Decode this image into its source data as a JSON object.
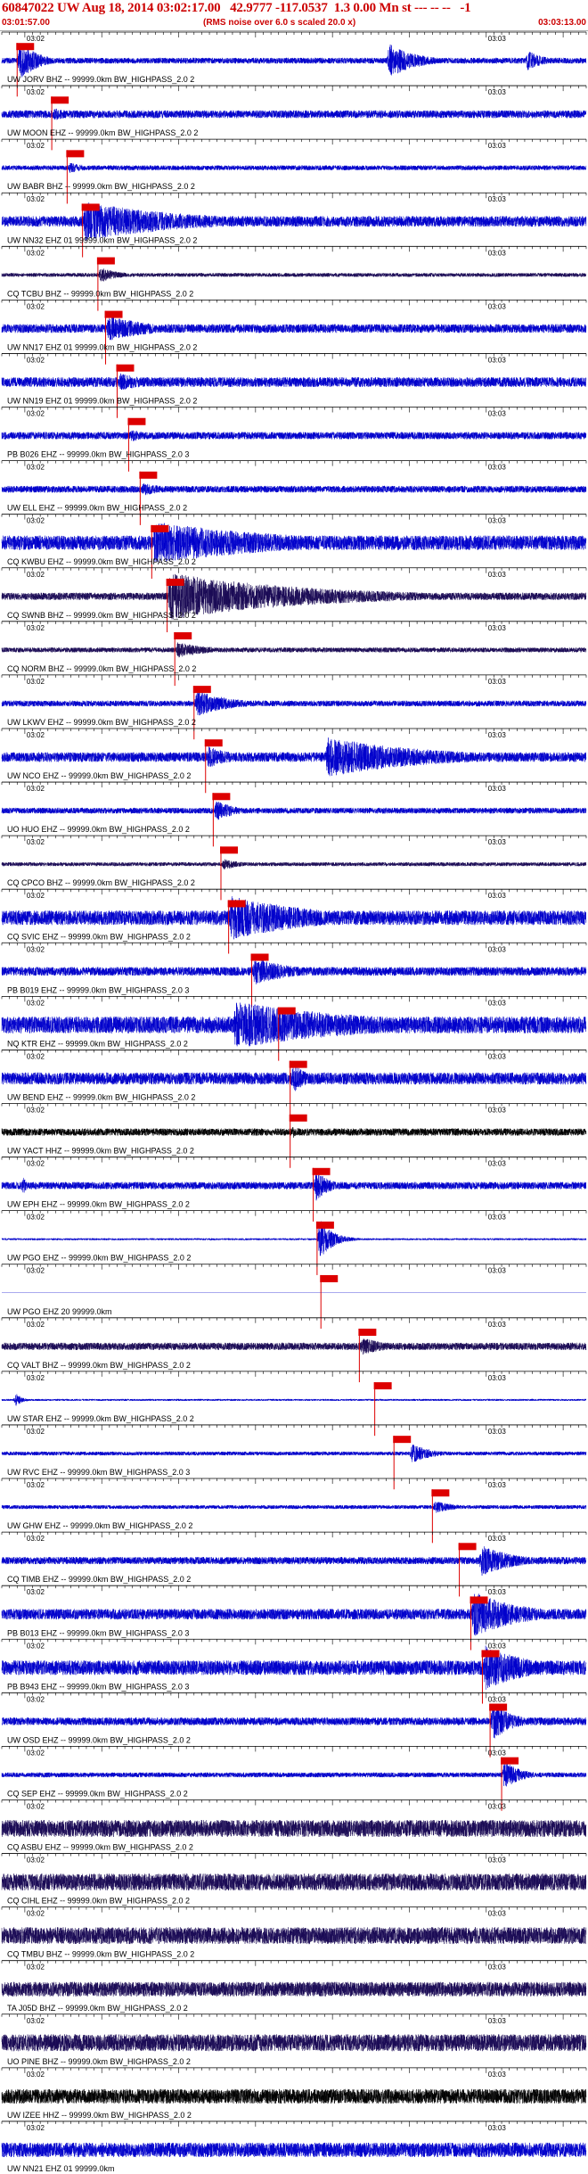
{
  "header": {
    "title": "60847022 UW Aug 18, 2014 03:02:17.00   42.9777 -117.0537  1.3 0.00 Mn st --- -- --   -1",
    "start_time": "03:01:57.00",
    "end_time": "03:03:13.00",
    "note": "(RMS noise over 6.0 s scaled 20.0 x)"
  },
  "colors": {
    "trace_default": "#0000cc",
    "trace_dark": "#1a0a55",
    "trace_black": "#000000",
    "pick": "#dd0000",
    "axis": "#000000",
    "label_text": "#000000"
  },
  "chart_data": {
    "type": "line",
    "title": "60847022 UW Aug 18, 2014 03:02:17.00   42.9777 -117.0537  1.3 0.00 Mn st --- -- --   -1",
    "x_range": [
      "03:01:57.00",
      "03:03:13.00"
    ],
    "axis_tick_labels": [
      "03:02",
      "03:03"
    ],
    "axis_tick_seconds": [
      3,
      63
    ],
    "total_seconds": 76,
    "traces": [
      {
        "label": "UW JORV BHZ -- 99999.0km BW_HIGHPASS_2.0  2",
        "pick": 2.0,
        "events": [
          {
            "t": 2.0,
            "dur": 5,
            "amp": 1.0
          },
          {
            "t": 50,
            "dur": 8,
            "amp": 0.8
          },
          {
            "t": 68,
            "dur": 5,
            "amp": 0.5
          }
        ],
        "noise": 0.12,
        "tone": "blue"
      },
      {
        "label": "UW MOON EHZ -- 99999.0km BW_HIGHPASS_2.0  2",
        "pick": 6.5,
        "events": [
          {
            "t": 6.5,
            "dur": 6,
            "amp": 0.3
          }
        ],
        "noise": 0.16,
        "tone": "blue"
      },
      {
        "label": "UW BABR BHZ -- 99999.0km BW_HIGHPASS_2.0  2",
        "pick": 8.5,
        "events": [
          {
            "t": 8.5,
            "dur": 6,
            "amp": 0.25
          }
        ],
        "noise": 0.1,
        "tone": "blue"
      },
      {
        "label": "UW NN32 EHZ 01 99999.0km BW_HIGHPASS_2.0  2",
        "pick": 10.5,
        "events": [
          {
            "t": 10.5,
            "dur": 30,
            "amp": 0.85
          }
        ],
        "noise": 0.22,
        "tone": "blue"
      },
      {
        "label": "CQ TCBU BHZ -- 99999.0km BW_HIGHPASS_2.0  2",
        "pick": 12.5,
        "events": [
          {
            "t": 12.5,
            "dur": 6,
            "amp": 0.35
          }
        ],
        "noise": 0.08,
        "tone": "dark"
      },
      {
        "label": "UW NN17 EHZ 01 99999.0km BW_HIGHPASS_2.0  2",
        "pick": 13.5,
        "events": [
          {
            "t": 13.5,
            "dur": 14,
            "amp": 0.55
          }
        ],
        "noise": 0.18,
        "tone": "blue"
      },
      {
        "label": "UW NN19 EHZ 01 99999.0km BW_HIGHPASS_2.0  2",
        "pick": 15.0,
        "events": [
          {
            "t": 15.0,
            "dur": 10,
            "amp": 0.4
          }
        ],
        "noise": 0.2,
        "tone": "blue"
      },
      {
        "label": "PB B026 EHZ -- 99999.0km BW_HIGHPASS_2.0  3",
        "pick": 16.5,
        "events": [
          {
            "t": 16.5,
            "dur": 6,
            "amp": 0.3
          }
        ],
        "noise": 0.15,
        "tone": "blue"
      },
      {
        "label": "UW ELL EHZ -- 99999.0km BW_HIGHPASS_2.0  2",
        "pick": 18.0,
        "events": [
          {
            "t": 18.0,
            "dur": 8,
            "amp": 0.3
          }
        ],
        "noise": 0.14,
        "tone": "blue"
      },
      {
        "label": "CQ KWBU EHZ -- 99999.0km BW_HIGHPASS_2.0  2",
        "pick": 19.5,
        "events": [
          {
            "t": 19.5,
            "dur": 40,
            "amp": 0.9
          }
        ],
        "noise": 0.3,
        "tone": "blue"
      },
      {
        "label": "CQ SWNB BHZ -- 99999.0km BW_HIGHPASS_2.0  2",
        "pick": 21.5,
        "events": [
          {
            "t": 21.5,
            "dur": 40,
            "amp": 1.0
          }
        ],
        "noise": 0.15,
        "tone": "dark"
      },
      {
        "label": "CQ NORM BHZ -- 99999.0km BW_HIGHPASS_2.0  2",
        "pick": 22.5,
        "events": [
          {
            "t": 22.5,
            "dur": 10,
            "amp": 0.35
          }
        ],
        "noise": 0.1,
        "tone": "dark"
      },
      {
        "label": "UW LKWV EHZ -- 99999.0km BW_HIGHPASS_2.0  2",
        "pick": 25.0,
        "events": [
          {
            "t": 25.0,
            "dur": 10,
            "amp": 0.6
          }
        ],
        "noise": 0.12,
        "tone": "blue"
      },
      {
        "label": "UW NCO EHZ -- 99999.0km BW_HIGHPASS_2.0  2",
        "pick": 26.5,
        "events": [
          {
            "t": 26.5,
            "dur": 8,
            "amp": 0.5
          },
          {
            "t": 42,
            "dur": 30,
            "amp": 0.85
          }
        ],
        "noise": 0.2,
        "tone": "blue"
      },
      {
        "label": "UO HUO EHZ -- 99999.0km BW_HIGHPASS_2.0  2",
        "pick": 27.5,
        "events": [
          {
            "t": 27.5,
            "dur": 6,
            "amp": 0.5
          }
        ],
        "noise": 0.12,
        "tone": "blue"
      },
      {
        "label": "CQ CPCO BHZ -- 99999.0km BW_HIGHPASS_2.0  2",
        "pick": 28.5,
        "events": [
          {
            "t": 28.5,
            "dur": 5,
            "amp": 0.3
          }
        ],
        "noise": 0.08,
        "tone": "dark"
      },
      {
        "label": "CQ SVIC EHZ -- 99999.0km BW_HIGHPASS_2.0  2",
        "pick": 29.5,
        "events": [
          {
            "t": 29.5,
            "dur": 25,
            "amp": 0.95
          }
        ],
        "noise": 0.3,
        "tone": "blue"
      },
      {
        "label": "PB B019 EHZ -- 99999.0km BW_HIGHPASS_2.0  3",
        "pick": 32.5,
        "events": [
          {
            "t": 32.5,
            "dur": 12,
            "amp": 0.6
          }
        ],
        "noise": 0.18,
        "tone": "blue"
      },
      {
        "label": "NQ KTR EHZ -- 99999.0km BW_HIGHPASS_2.0  2",
        "pick": 36.0,
        "events": [
          {
            "t": 30,
            "dur": 40,
            "amp": 1.0
          }
        ],
        "noise": 0.35,
        "tone": "blue"
      },
      {
        "label": "UW BEND EHZ -- 99999.0km BW_HIGHPASS_2.0  2",
        "pick": 37.5,
        "events": [
          {
            "t": 37.5,
            "dur": 5,
            "amp": 0.7
          }
        ],
        "noise": 0.25,
        "tone": "blue"
      },
      {
        "label": "UW YACT HHZ -- 99999.0km BW_HIGHPASS_2.0  2",
        "pick": 37.5,
        "events": [
          {
            "t": 37.5,
            "dur": 4,
            "amp": 0.3
          }
        ],
        "noise": 0.15,
        "tone": "black"
      },
      {
        "label": "UW EPH EHZ -- 99999.0km BW_HIGHPASS_2.0  2",
        "pick": 40.5,
        "events": [
          {
            "t": 2.5,
            "dur": 1,
            "amp": 0.8
          },
          {
            "t": 40.5,
            "dur": 4,
            "amp": 0.8
          }
        ],
        "noise": 0.15,
        "tone": "blue"
      },
      {
        "label": "UW PGO EHZ -- 99999.0km BW_HIGHPASS_2.0  2",
        "pick": 41.0,
        "events": [
          {
            "t": 41.0,
            "dur": 4,
            "amp": 1.0
          }
        ],
        "noise": 0.04,
        "tone": "blue"
      },
      {
        "label": "UW PGO EHZ 20 99999.0km",
        "pick": 41.5,
        "events": [],
        "noise": 0.0,
        "tone": "blue"
      },
      {
        "label": "CQ VALT BHZ -- 99999.0km BW_HIGHPASS_2.0  2",
        "pick": 46.5,
        "events": [
          {
            "t": 46.5,
            "dur": 8,
            "amp": 0.4
          }
        ],
        "noise": 0.15,
        "tone": "dark"
      },
      {
        "label": "UW STAR EHZ -- 99999.0km BW_HIGHPASS_2.0  2",
        "pick": 48.5,
        "events": [
          {
            "t": 1.5,
            "dur": 2,
            "amp": 0.4
          }
        ],
        "noise": 0.04,
        "tone": "blue"
      },
      {
        "label": "UW RVC EHZ -- 99999.0km BW_HIGHPASS_2.0  3",
        "pick": 51.0,
        "events": [
          {
            "t": 53,
            "dur": 6,
            "amp": 0.45
          }
        ],
        "noise": 0.08,
        "tone": "blue"
      },
      {
        "label": "UW GHW EHZ -- 99999.0km BW_HIGHPASS_2.0  2",
        "pick": 56.0,
        "events": [
          {
            "t": 56.0,
            "dur": 6,
            "amp": 0.3
          }
        ],
        "noise": 0.08,
        "tone": "blue"
      },
      {
        "label": "CQ TIMB EHZ -- 99999.0km BW_HIGHPASS_2.0  2",
        "pick": 59.5,
        "events": [
          {
            "t": 62,
            "dur": 10,
            "amp": 0.7
          }
        ],
        "noise": 0.15,
        "tone": "blue"
      },
      {
        "label": "PB B013 EHZ -- 99999.0km BW_HIGHPASS_2.0  3",
        "pick": 61.0,
        "events": [
          {
            "t": 61.0,
            "dur": 14,
            "amp": 1.0
          }
        ],
        "noise": 0.22,
        "tone": "blue"
      },
      {
        "label": "PB B943 EHZ -- 99999.0km BW_HIGHPASS_2.0  3",
        "pick": 62.5,
        "events": [
          {
            "t": 62.5,
            "dur": 13,
            "amp": 1.0
          }
        ],
        "noise": 0.3,
        "tone": "blue"
      },
      {
        "label": "UW OSD EHZ -- 99999.0km BW_HIGHPASS_2.0  2",
        "pick": 63.5,
        "events": [
          {
            "t": 63.5,
            "dur": 6,
            "amp": 0.9
          }
        ],
        "noise": 0.16,
        "tone": "blue"
      },
      {
        "label": "CQ SEP EHZ -- 99999.0km BW_HIGHPASS_2.0  2",
        "pick": 65.0,
        "events": [
          {
            "t": 65.0,
            "dur": 5,
            "amp": 0.7
          }
        ],
        "noise": 0.1,
        "tone": "blue"
      },
      {
        "label": "CQ ASBU EHZ -- 99999.0km BW_HIGHPASS_2.0  2",
        "pick": null,
        "events": [],
        "noise": 0.35,
        "tone": "dark"
      },
      {
        "label": "CQ CIHL EHZ -- 99999.0km BW_HIGHPASS_2.0  2",
        "pick": null,
        "events": [],
        "noise": 0.35,
        "tone": "dark"
      },
      {
        "label": "CQ TMBU BHZ -- 99999.0km BW_HIGHPASS_2.0  2",
        "pick": null,
        "events": [],
        "noise": 0.35,
        "tone": "dark"
      },
      {
        "label": "TA J05D BHZ -- 99999.0km BW_HIGHPASS_2.0  2",
        "pick": null,
        "events": [],
        "noise": 0.3,
        "tone": "dark"
      },
      {
        "label": "UO PINE BHZ -- 99999.0km BW_HIGHPASS_2.0  2",
        "pick": null,
        "events": [],
        "noise": 0.35,
        "tone": "dark"
      },
      {
        "label": "UW IZEE HHZ -- 99999.0km BW_HIGHPASS_2.0  2",
        "pick": null,
        "events": [],
        "noise": 0.3,
        "tone": "black"
      },
      {
        "label": "UW NN21 EHZ 01 99999.0km",
        "pick": null,
        "events": [],
        "noise": 0.3,
        "tone": "blue"
      }
    ]
  }
}
